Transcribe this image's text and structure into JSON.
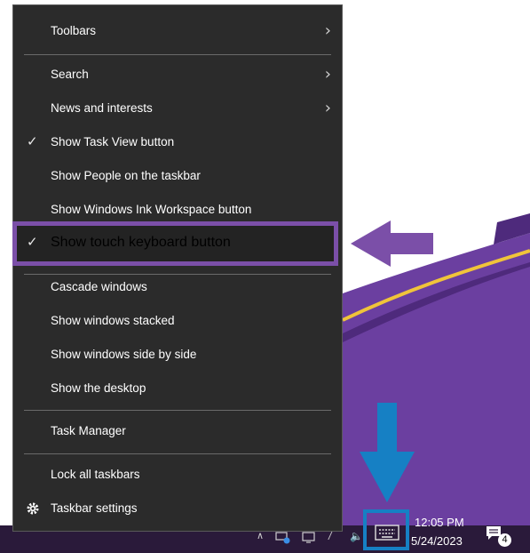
{
  "menu": {
    "items": [
      {
        "label": "Toolbars",
        "checked": false,
        "submenu": true
      },
      {
        "label": "Search",
        "checked": false,
        "submenu": true
      },
      {
        "label": "News and interests",
        "checked": false,
        "submenu": true
      },
      {
        "label": "Show Task View button",
        "checked": true,
        "submenu": false
      },
      {
        "label": "Show People on the taskbar",
        "checked": false,
        "submenu": false
      },
      {
        "label": "Show Windows Ink Workspace button",
        "checked": false,
        "submenu": false
      },
      {
        "label": "Show touch keyboard button",
        "checked": true,
        "submenu": false
      },
      {
        "label": "Cascade windows",
        "checked": false,
        "submenu": false
      },
      {
        "label": "Show windows stacked",
        "checked": false,
        "submenu": false
      },
      {
        "label": "Show windows side by side",
        "checked": false,
        "submenu": false
      },
      {
        "label": "Show the desktop",
        "checked": false,
        "submenu": false
      },
      {
        "label": "Task Manager",
        "checked": false,
        "submenu": false
      },
      {
        "label": "Lock all taskbars",
        "checked": false,
        "submenu": false
      },
      {
        "label": "Taskbar settings",
        "checked": false,
        "submenu": false,
        "icon": "gear-icon"
      }
    ],
    "check_glyph": "✓",
    "chevron_glyph": "›"
  },
  "taskbar": {
    "time": "12:05 PM",
    "date": "5/24/2023",
    "notification_count": "4",
    "icons": [
      "chevron-up-icon",
      "network-icon",
      "display-icon",
      "pen-icon",
      "volume-icon",
      "keyboard-icon",
      "notification-icon"
    ]
  },
  "colors": {
    "menu_bg": "#2b2b2b",
    "highlight": "#7b4fa8",
    "annotation_blue": "#1680c4",
    "wallpaper_purple": "#6b3fa0"
  }
}
